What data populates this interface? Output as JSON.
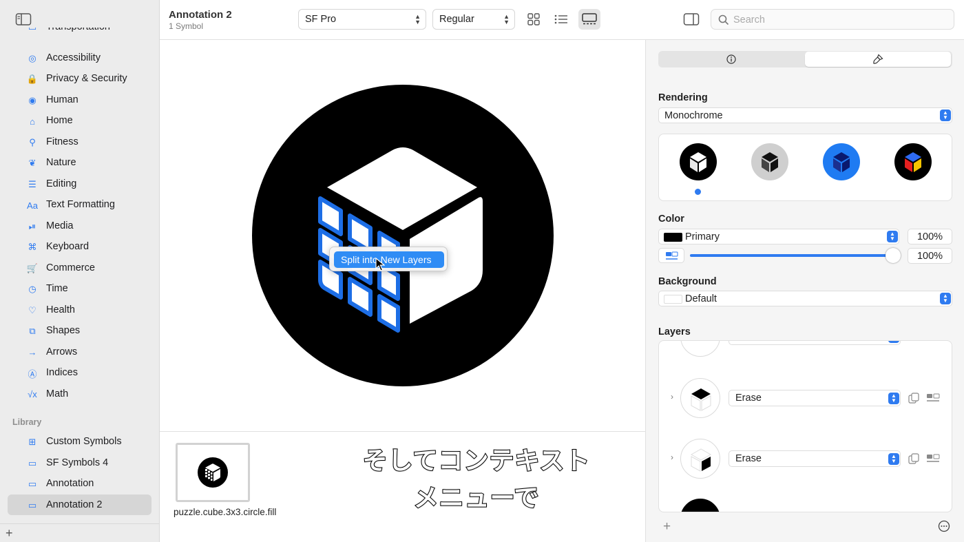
{
  "sidebar": {
    "items": [
      {
        "label": "Transportation",
        "icon": "car-icon"
      },
      {
        "label": "Accessibility",
        "icon": "accessibility-icon"
      },
      {
        "label": "Privacy & Security",
        "icon": "lock-icon"
      },
      {
        "label": "Human",
        "icon": "person-circle-icon"
      },
      {
        "label": "Home",
        "icon": "house-icon"
      },
      {
        "label": "Fitness",
        "icon": "figure-run-icon"
      },
      {
        "label": "Nature",
        "icon": "leaf-icon"
      },
      {
        "label": "Editing",
        "icon": "slider-icon"
      },
      {
        "label": "Text Formatting",
        "icon": "textformat-icon"
      },
      {
        "label": "Media",
        "icon": "play-pause-icon"
      },
      {
        "label": "Keyboard",
        "icon": "command-icon"
      },
      {
        "label": "Commerce",
        "icon": "cart-icon"
      },
      {
        "label": "Time",
        "icon": "clock-icon"
      },
      {
        "label": "Health",
        "icon": "heart-icon"
      },
      {
        "label": "Shapes",
        "icon": "shapes-icon"
      },
      {
        "label": "Arrows",
        "icon": "arrow-right-icon"
      },
      {
        "label": "Indices",
        "icon": "a-circle-icon"
      },
      {
        "label": "Math",
        "icon": "sqrt-icon"
      }
    ],
    "icon_glyphs": [
      "▭",
      "◎",
      "🔒",
      "◉",
      "⌂",
      "⚲",
      "❦",
      "☰",
      "Aa",
      "⏯",
      "⌘",
      "🛒",
      "◷",
      "♡",
      "⧉",
      "→",
      "Ⓐ",
      "√x"
    ],
    "library_header": "Library",
    "library": [
      {
        "label": "Custom Symbols",
        "icon": "grid-icon",
        "glyph": "⊞"
      },
      {
        "label": "SF Symbols 4",
        "icon": "folder-icon",
        "glyph": "▭"
      },
      {
        "label": "Annotation",
        "icon": "folder-icon",
        "glyph": "▭"
      },
      {
        "label": "Annotation 2",
        "icon": "folder-icon",
        "glyph": "▭",
        "selected": true
      }
    ],
    "footer_add": "+"
  },
  "toolbar": {
    "title": "Annotation 2",
    "subtitle": "1 Symbol",
    "font": "SF Pro",
    "weight": "Regular",
    "search_placeholder": "Search"
  },
  "canvas": {
    "context_menu_item": "Split into New Layers"
  },
  "bottom": {
    "symbol_name": "puzzle.cube.3x3.circle.fill",
    "caption_line1": "そしてコンテキスト",
    "caption_line2": "メニューで"
  },
  "inspector": {
    "rendering_label": "Rendering",
    "rendering_value": "Monochrome",
    "color_label": "Color",
    "color_value": "Primary",
    "color_opacity": "100%",
    "slider_value": "100%",
    "background_label": "Background",
    "background_value": "Default",
    "layers_label": "Layers",
    "layers": [
      {
        "mode": "Erase"
      },
      {
        "mode": "Erase"
      }
    ],
    "accent": "#2f7bf0"
  }
}
